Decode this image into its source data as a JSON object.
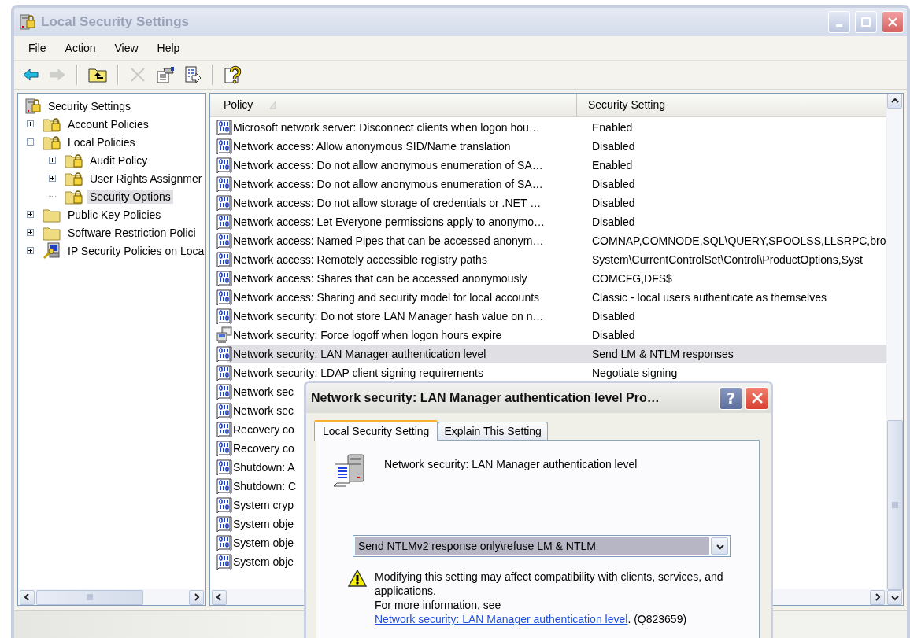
{
  "window": {
    "title": "Local Security Settings",
    "active": false
  },
  "menu": [
    {
      "label": "File"
    },
    {
      "label": "Action"
    },
    {
      "label": "View"
    },
    {
      "label": "Help"
    }
  ],
  "toolbar": [
    {
      "kind": "back",
      "disabled": false
    },
    {
      "kind": "forward",
      "disabled": true
    },
    {
      "kind": "separator"
    },
    {
      "kind": "up",
      "disabled": false
    },
    {
      "kind": "separator"
    },
    {
      "kind": "delete",
      "disabled": true
    },
    {
      "kind": "properties",
      "disabled": false
    },
    {
      "kind": "export",
      "disabled": false
    },
    {
      "kind": "separator"
    },
    {
      "kind": "help",
      "disabled": false
    }
  ],
  "tree": [
    {
      "label": "Security Settings",
      "kind": "root",
      "selected": false,
      "children": [
        {
          "label": "Account Policies",
          "kind": "locked-folder",
          "expanded": false,
          "selected": false
        },
        {
          "label": "Local Policies",
          "kind": "locked-folder",
          "expanded": true,
          "selected": false,
          "children": [
            {
              "label": "Audit Policy",
              "kind": "locked-folder",
              "expanded": false,
              "selected": false
            },
            {
              "label": "User Rights Assignmer",
              "kind": "locked-folder",
              "expanded": false,
              "selected": false
            },
            {
              "label": "Security Options",
              "kind": "locked-folder",
              "selected": true
            }
          ]
        },
        {
          "label": "Public Key Policies",
          "kind": "folder",
          "expanded": false,
          "selected": false
        },
        {
          "label": "Software Restriction Polici",
          "kind": "folder",
          "expanded": false,
          "selected": false
        },
        {
          "label": "IP Security Policies on Loca",
          "kind": "ip-security",
          "expanded": false,
          "selected": false
        }
      ]
    }
  ],
  "list": {
    "columns": [
      {
        "label": "Policy",
        "sorted": true
      },
      {
        "label": "Security Setting",
        "sorted": false
      }
    ],
    "rows": [
      {
        "kind": "policy",
        "policy": "Microsoft network server: Disconnect clients when logon hou…",
        "setting": "Enabled",
        "selected": false
      },
      {
        "kind": "policy",
        "policy": "Network access: Allow anonymous SID/Name translation",
        "setting": "Disabled",
        "selected": false
      },
      {
        "kind": "policy",
        "policy": "Network access: Do not allow anonymous enumeration of SA…",
        "setting": "Enabled",
        "selected": false
      },
      {
        "kind": "policy",
        "policy": "Network access: Do not allow anonymous enumeration of SA…",
        "setting": "Disabled",
        "selected": false
      },
      {
        "kind": "policy",
        "policy": "Network access: Do not allow storage of credentials or .NET …",
        "setting": "Disabled",
        "selected": false
      },
      {
        "kind": "policy",
        "policy": "Network access: Let Everyone permissions apply to anonymo…",
        "setting": "Disabled",
        "selected": false
      },
      {
        "kind": "policy",
        "policy": "Network access: Named Pipes that can be accessed anonym…",
        "setting": "COMNAP,COMNODE,SQL\\QUERY,SPOOLSS,LLSRPC,bro",
        "selected": false
      },
      {
        "kind": "policy",
        "policy": "Network access: Remotely accessible registry paths",
        "setting": "System\\CurrentControlSet\\Control\\ProductOptions,Syst",
        "selected": false
      },
      {
        "kind": "policy",
        "policy": "Network access: Shares that can be accessed anonymously",
        "setting": "COMCFG,DFS$",
        "selected": false
      },
      {
        "kind": "policy",
        "policy": "Network access: Sharing and security model for local accounts",
        "setting": "Classic - local users authenticate as themselves",
        "selected": false
      },
      {
        "kind": "policy",
        "policy": "Network security: Do not store LAN Manager hash value on n…",
        "setting": "Disabled",
        "selected": false
      },
      {
        "kind": "computer",
        "policy": "Network security: Force logoff when logon hours expire",
        "setting": "Disabled",
        "selected": false
      },
      {
        "kind": "policy",
        "policy": "Network security: LAN Manager authentication level",
        "setting": "Send LM & NTLM responses",
        "selected": true
      },
      {
        "kind": "policy",
        "policy": "Network security: LDAP client signing requirements",
        "setting": "Negotiate signing",
        "selected": false
      },
      {
        "kind": "policy",
        "policy": "Network sec",
        "selected": false
      },
      {
        "kind": "policy",
        "policy": "Network sec",
        "selected": false
      },
      {
        "kind": "policy",
        "policy": "Recovery co",
        "selected": false
      },
      {
        "kind": "policy",
        "policy": "Recovery co",
        "selected": false
      },
      {
        "kind": "policy",
        "policy": "Shutdown: A",
        "selected": false
      },
      {
        "kind": "policy",
        "policy": "Shutdown: C",
        "selected": false
      },
      {
        "kind": "policy",
        "policy": "System cryp",
        "selected": false
      },
      {
        "kind": "policy",
        "policy": "System obje",
        "selected": false
      },
      {
        "kind": "policy",
        "policy": "System obje",
        "selected": false
      },
      {
        "kind": "policy",
        "policy": "System obje",
        "selected": false
      }
    ]
  },
  "dialog": {
    "title": "Network security: LAN Manager authentication level Pro…",
    "help_button": "?",
    "tabs": [
      {
        "label": "Local Security Setting",
        "selected": true
      },
      {
        "label": "Explain This Setting",
        "selected": false
      }
    ],
    "policy_name": "Network security: LAN Manager authentication level",
    "value": "Send NTLMv2 response only\\refuse LM & NTLM",
    "warning": "Modifying this setting may affect compatibility with clients, services, and applications.",
    "info": {
      "text": "For more information, see ",
      "link": "Network security: LAN Manager authentication level",
      "after": ". (Q823659)"
    }
  }
}
